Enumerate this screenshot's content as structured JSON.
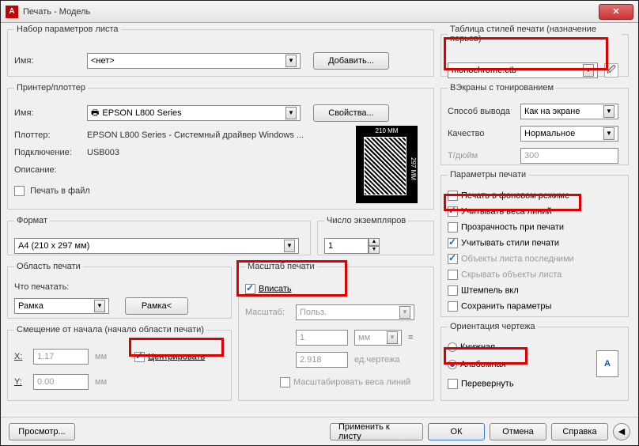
{
  "title": "Печать - Модель",
  "pageSetup": {
    "legend": "Набор параметров листа",
    "nameLabel": "Имя:",
    "nameValue": "<нет>",
    "addBtn": "Добавить..."
  },
  "plotStyle": {
    "legend": "Таблица стилей печати (назначение перьев)",
    "value": "monochrome.ctb"
  },
  "printer": {
    "legend": "Принтер/плоттер",
    "nameLabel": "Имя:",
    "nameValue": "EPSON L800 Series",
    "propsBtn": "Свойства...",
    "plotterLabel": "Плоттер:",
    "plotterValue": "EPSON L800 Series - Системный драйвер Windows ...",
    "portLabel": "Подключение:",
    "portValue": "USB003",
    "descLabel": "Описание:",
    "toFile": "Печать в файл",
    "previewTop": "210 MM",
    "previewSide": "297 MM"
  },
  "viewports": {
    "legend": "ВЭкраны с тонированием",
    "outLabel": "Способ вывода",
    "outValue": "Как на экране",
    "qLabel": "Качество",
    "qValue": "Нормальное",
    "tLabel": "Т/дюйм",
    "tValue": "300"
  },
  "options": {
    "legend": "Параметры печати",
    "bg": "Печать в фоновом режиме",
    "lw": "Учитывать веса линий",
    "trans": "Прозрачность при печати",
    "styles": "Учитывать стили печати",
    "last": "Объекты листа последними",
    "hide": "Скрывать объекты листа",
    "stamp": "Штемпель вкл",
    "save": "Сохранить параметры"
  },
  "paper": {
    "legend": "Формат",
    "value": "A4 (210 x 297 мм)"
  },
  "copies": {
    "legend": "Число экземпляров",
    "value": "1"
  },
  "area": {
    "legend": "Область печати",
    "whatLabel": "Что печатать:",
    "whatValue": "Рамка",
    "windowBtn": "Рамка<"
  },
  "scale": {
    "legend": "Масштаб печати",
    "fit": "Вписать",
    "scaleLabel": "Масштаб:",
    "scaleValue": "Польз.",
    "num": "1",
    "unit": "мм",
    "den": "2.918",
    "denUnit": "ед.чертежа",
    "scaleLW": "Масштабировать веса линий",
    "eq": "="
  },
  "offset": {
    "legend": "Смещение от начала (начало области печати)",
    "xLabel": "X:",
    "xValue": "1.17",
    "yLabel": "Y:",
    "yValue": "0.00",
    "unit": "мм",
    "center": "Центрировать"
  },
  "orient": {
    "legend": "Ориентация чертежа",
    "portrait": "Книжная",
    "landscape": "Альбомная",
    "upside": "Перевернуть",
    "letter": "A"
  },
  "footer": {
    "preview": "Просмотр...",
    "apply": "Применить к листу",
    "ok": "ОК",
    "cancel": "Отмена",
    "help": "Справка"
  }
}
